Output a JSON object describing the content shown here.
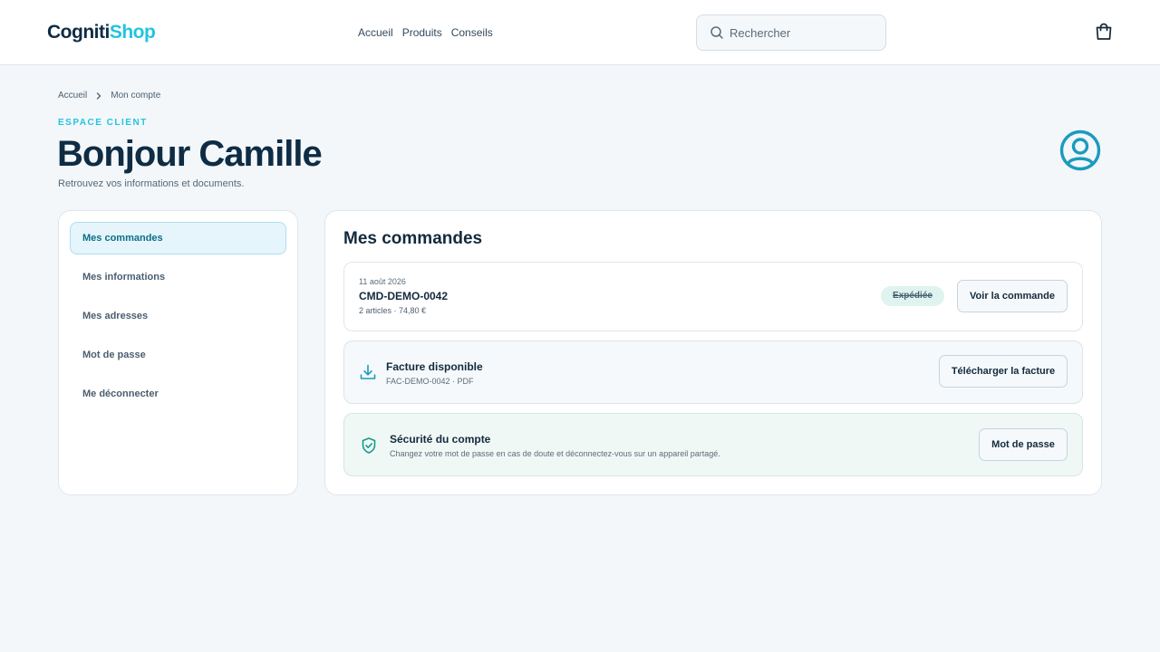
{
  "header": {
    "logo_part1": "Cogniti",
    "logo_part2": "Shop",
    "nav": [
      "Accueil",
      "Produits",
      "Conseils"
    ],
    "search_placeholder": "Rechercher",
    "cart_icon": "shopping-bag-icon"
  },
  "breadcrumb": {
    "home": "Accueil",
    "current": "Mon compte"
  },
  "page": {
    "eyebrow": "ESPACE CLIENT",
    "title": "Bonjour Camille",
    "subtitle": "Retrouvez vos informations et documents.",
    "avatar_icon": "user-circle-icon"
  },
  "sidebar": {
    "items": [
      {
        "label": "Mes commandes",
        "active": true
      },
      {
        "label": "Mes informations",
        "active": false
      },
      {
        "label": "Mes adresses",
        "active": false
      },
      {
        "label": "Mot de passe",
        "active": false
      },
      {
        "label": "Me déconnecter",
        "active": false
      }
    ]
  },
  "main": {
    "title": "Mes commandes",
    "order": {
      "date": "11 août 2026",
      "id": "CMD-DEMO-0042",
      "meta": "2 articles · 74,80 €",
      "status": "Expédiée",
      "button": "Voir la commande"
    },
    "invoice": {
      "title": "Facture disponible",
      "sub": "FAC-DEMO-0042 · PDF",
      "button": "Télécharger la facture",
      "icon": "download-icon"
    },
    "security": {
      "title": "Sécurité du compte",
      "sub": "Changez votre mot de passe en cas de doute et déconnectez-vous sur un appareil partagé.",
      "button": "Mot de passe",
      "icon": "shield-check-icon"
    }
  },
  "colors": {
    "brand_dark": "#0e2c44",
    "brand_accent": "#22c4e0",
    "active_item_bg": "#e6f5fb",
    "status_bg": "#dff4ef",
    "security_bg": "#f0f8f5",
    "icon_teal": "#1b9bbd"
  }
}
